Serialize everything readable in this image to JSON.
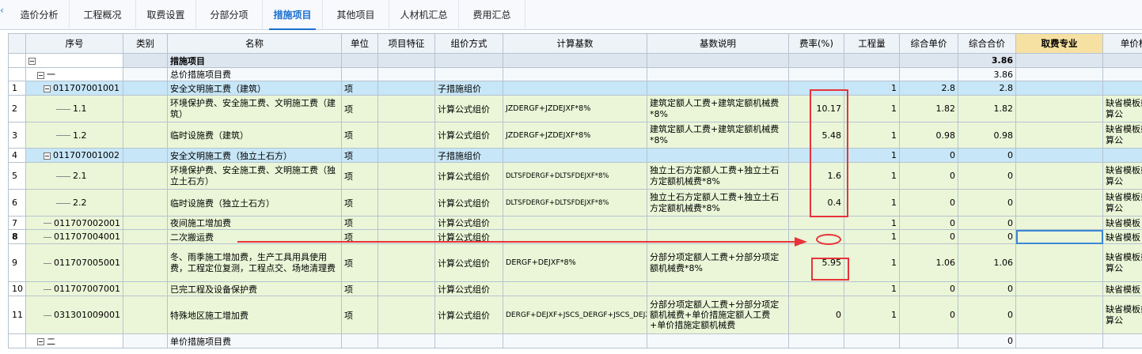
{
  "tabs": [
    {
      "label": "造价分析",
      "active": false
    },
    {
      "label": "工程概况",
      "active": false
    },
    {
      "label": "取费设置",
      "active": false
    },
    {
      "label": "分部分项",
      "active": false
    },
    {
      "label": "措施项目",
      "active": true
    },
    {
      "label": "其他项目",
      "active": false
    },
    {
      "label": "人材机汇总",
      "active": false
    },
    {
      "label": "费用汇总",
      "active": false
    }
  ],
  "columns": [
    "序号",
    "类别",
    "名称",
    "单位",
    "项目特征",
    "组价方式",
    "计算基数",
    "基数说明",
    "费率(%)",
    "工程量",
    "综合单价",
    "综合合价",
    "取费专业",
    "单价构"
  ],
  "rows": [
    {
      "rownum": "",
      "seq": "",
      "type": "",
      "name": "措施项目",
      "unit": "",
      "feature": "",
      "method": "",
      "base": "",
      "base_desc": "",
      "rate": "",
      "qty": "",
      "unit_price": "",
      "total": "3.86",
      "fee": "",
      "uc": ""
    },
    {
      "rownum": "",
      "seq": "一",
      "type": "",
      "name": "总价措施项目费",
      "unit": "",
      "feature": "",
      "method": "",
      "base": "",
      "base_desc": "",
      "rate": "",
      "qty": "",
      "unit_price": "",
      "total": "3.86",
      "fee": "",
      "uc": ""
    },
    {
      "rownum": "1",
      "seq": "011707001001",
      "type": "",
      "name": "安全文明施工费（建筑）",
      "unit": "项",
      "feature": "",
      "method": "子措施组价",
      "base": "",
      "base_desc": "",
      "rate": "",
      "qty": "1",
      "unit_price": "2.8",
      "total": "2.8",
      "fee": "",
      "uc": ""
    },
    {
      "rownum": "2",
      "seq": "1.1",
      "type": "",
      "name": "环境保护费、安全施工费、文明施工费（建筑）",
      "unit": "项",
      "feature": "",
      "method": "计算公式组价",
      "base": "JZDERGF+JZDEJXF*8%",
      "base_desc": "建筑定额人工费+建筑定额机械费*8%",
      "rate": "10.17",
      "qty": "1",
      "unit_price": "1.82",
      "total": "1.82",
      "fee": "",
      "uc": "缺省模板或计算公"
    },
    {
      "rownum": "3",
      "seq": "1.2",
      "type": "",
      "name": "临时设施费（建筑）",
      "unit": "项",
      "feature": "",
      "method": "计算公式组价",
      "base": "JZDERGF+JZDEJXF*8%",
      "base_desc": "建筑定额人工费+建筑定额机械费*8%",
      "rate": "5.48",
      "qty": "1",
      "unit_price": "0.98",
      "total": "0.98",
      "fee": "",
      "uc": "缺省模板或计算公"
    },
    {
      "rownum": "4",
      "seq": "011707001002",
      "type": "",
      "name": "安全文明施工费（独立土石方）",
      "unit": "项",
      "feature": "",
      "method": "子措施组价",
      "base": "",
      "base_desc": "",
      "rate": "",
      "qty": "1",
      "unit_price": "0",
      "total": "0",
      "fee": "",
      "uc": ""
    },
    {
      "rownum": "5",
      "seq": "2.1",
      "type": "",
      "name": "环境保护费、安全施工费、文明施工费（独立土石方）",
      "unit": "项",
      "feature": "",
      "method": "计算公式组价",
      "base": "DLTSFDERGF+DLTSFDEJXF*8%",
      "base_desc": "独立土石方定额人工费+独立土石方定额机械费*8%",
      "rate": "1.6",
      "qty": "1",
      "unit_price": "0",
      "total": "0",
      "fee": "",
      "uc": "缺省模板或计算公"
    },
    {
      "rownum": "6",
      "seq": "2.2",
      "type": "",
      "name": "临时设施费（独立土石方）",
      "unit": "项",
      "feature": "",
      "method": "计算公式组价",
      "base": "DLTSFDERGF+DLTSFDEJXF*8%",
      "base_desc": "独立土石方定额人工费+独立土石方定额机械费*8%",
      "rate": "0.4",
      "qty": "1",
      "unit_price": "0",
      "total": "0",
      "fee": "",
      "uc": "缺省模板或计算公"
    },
    {
      "rownum": "7",
      "seq": "011707002001",
      "type": "",
      "name": "夜间施工增加费",
      "unit": "项",
      "feature": "",
      "method": "计算公式组价",
      "base": "",
      "base_desc": "",
      "rate": "",
      "qty": "1",
      "unit_price": "0",
      "total": "0",
      "fee": "",
      "uc": "缺省模板"
    },
    {
      "rownum": "8",
      "seq": "011707004001",
      "type": "",
      "name": "二次搬运费",
      "unit": "项",
      "feature": "",
      "method": "计算公式组价",
      "base": "",
      "base_desc": "",
      "rate": "",
      "qty": "1",
      "unit_price": "0",
      "total": "0",
      "fee": "",
      "uc": "缺省模板"
    },
    {
      "rownum": "9",
      "seq": "011707005001",
      "type": "",
      "name": "冬、雨季施工增加费，生产工具用具使用费，工程定位复测，工程点交、场地清理费",
      "unit": "项",
      "feature": "",
      "method": "计算公式组价",
      "base": "DERGF+DEJXF*8%",
      "base_desc": "分部分项定额人工费+分部分项定额机械费*8%",
      "rate": "5.95",
      "qty": "1",
      "unit_price": "1.06",
      "total": "1.06",
      "fee": "",
      "uc": "缺省模板或计算公"
    },
    {
      "rownum": "10",
      "seq": "011707007001",
      "type": "",
      "name": "已完工程及设备保护费",
      "unit": "项",
      "feature": "",
      "method": "计算公式组价",
      "base": "",
      "base_desc": "",
      "rate": "",
      "qty": "1",
      "unit_price": "0",
      "total": "0",
      "fee": "",
      "uc": "缺省模板"
    },
    {
      "rownum": "11",
      "seq": "031301009001",
      "type": "",
      "name": "特殊地区施工增加费",
      "unit": "项",
      "feature": "",
      "method": "计算公式组价",
      "base": "DERGF+DEJXF+JSCS_DERGF+JSCS_DEJXF",
      "base_desc": "分部分项定额人工费+分部分项定额机械费+单价措施定额人工费+单价措施定额机械费",
      "rate": "0",
      "qty": "1",
      "unit_price": "0",
      "total": "0",
      "fee": "",
      "uc": "缺省模板或计算公"
    },
    {
      "rownum": "",
      "seq": "二",
      "type": "",
      "name": "单价措施项目费",
      "unit": "",
      "feature": "",
      "method": "",
      "base": "",
      "base_desc": "",
      "rate": "",
      "qty": "",
      "unit_price": "",
      "total": "0",
      "fee": "",
      "uc": ""
    }
  ],
  "colors": {
    "accent": "#1a6fd1",
    "annotation": "#e8333a",
    "header_highlight": "#f7e1a2",
    "row_blue": "#c7e6f7",
    "row_green": "#eaf6d7"
  }
}
